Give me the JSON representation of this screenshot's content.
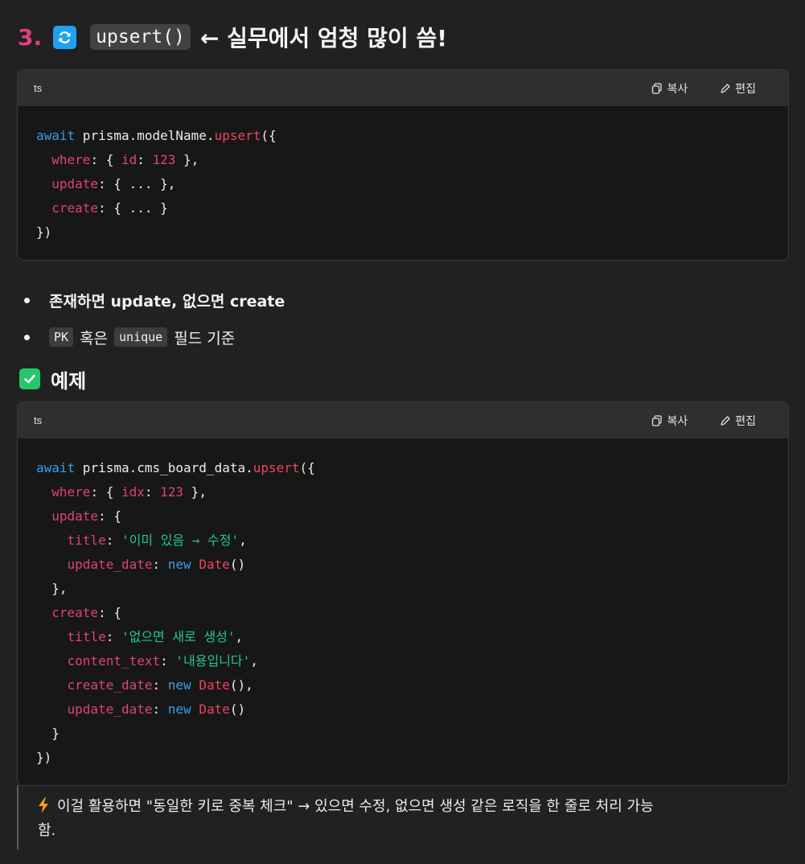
{
  "section": {
    "number": "3.",
    "code_title": "upsert()",
    "title_rest": "← 실무에서 엄청 많이 씀!"
  },
  "codeblock1": {
    "lang": "ts",
    "copy_label": "복사",
    "edit_label": "편집",
    "lines": [
      [
        {
          "t": "await",
          "c": "kw"
        },
        {
          "t": " prisma.modelName."
        },
        {
          "t": "upsert",
          "c": "fn"
        },
        {
          "t": "({"
        }
      ],
      [
        {
          "t": "  "
        },
        {
          "t": "where",
          "c": "prop"
        },
        {
          "t": ": { "
        },
        {
          "t": "id",
          "c": "prop"
        },
        {
          "t": ": "
        },
        {
          "t": "123",
          "c": "num"
        },
        {
          "t": " },"
        }
      ],
      [
        {
          "t": "  "
        },
        {
          "t": "update",
          "c": "prop"
        },
        {
          "t": ": { ... },"
        }
      ],
      [
        {
          "t": "  "
        },
        {
          "t": "create",
          "c": "prop"
        },
        {
          "t": ": { ... }"
        }
      ],
      [
        {
          "t": "})"
        }
      ]
    ]
  },
  "bullets": {
    "item1": "존재하면 update, 없으면 create",
    "item2_code1": "PK",
    "item2_mid": "혹은",
    "item2_code2": "unique",
    "item2_end": "필드 기준"
  },
  "example_heading": "예제",
  "codeblock2": {
    "lang": "ts",
    "copy_label": "복사",
    "edit_label": "편집",
    "lines": [
      [
        {
          "t": "await",
          "c": "kw"
        },
        {
          "t": " prisma.cms_board_data."
        },
        {
          "t": "upsert",
          "c": "fn"
        },
        {
          "t": "({"
        }
      ],
      [
        {
          "t": "  "
        },
        {
          "t": "where",
          "c": "prop"
        },
        {
          "t": ": { "
        },
        {
          "t": "idx",
          "c": "prop"
        },
        {
          "t": ": "
        },
        {
          "t": "123",
          "c": "num"
        },
        {
          "t": " },"
        }
      ],
      [
        {
          "t": "  "
        },
        {
          "t": "update",
          "c": "prop"
        },
        {
          "t": ": {"
        }
      ],
      [
        {
          "t": "    "
        },
        {
          "t": "title",
          "c": "prop"
        },
        {
          "t": ": "
        },
        {
          "t": "'이미 있음 → 수정'",
          "c": "str"
        },
        {
          "t": ","
        }
      ],
      [
        {
          "t": "    "
        },
        {
          "t": "update_date",
          "c": "prop"
        },
        {
          "t": ": "
        },
        {
          "t": "new",
          "c": "kw"
        },
        {
          "t": " "
        },
        {
          "t": "Date",
          "c": "fn"
        },
        {
          "t": "()"
        }
      ],
      [
        {
          "t": "  },"
        }
      ],
      [
        {
          "t": "  "
        },
        {
          "t": "create",
          "c": "prop"
        },
        {
          "t": ": {"
        }
      ],
      [
        {
          "t": "    "
        },
        {
          "t": "title",
          "c": "prop"
        },
        {
          "t": ": "
        },
        {
          "t": "'없으면 새로 생성'",
          "c": "str"
        },
        {
          "t": ","
        }
      ],
      [
        {
          "t": "    "
        },
        {
          "t": "content_text",
          "c": "prop"
        },
        {
          "t": ": "
        },
        {
          "t": "'내용입니다'",
          "c": "str"
        },
        {
          "t": ","
        }
      ],
      [
        {
          "t": "    "
        },
        {
          "t": "create_date",
          "c": "prop"
        },
        {
          "t": ": "
        },
        {
          "t": "new",
          "c": "kw"
        },
        {
          "t": " "
        },
        {
          "t": "Date",
          "c": "fn"
        },
        {
          "t": "(),"
        }
      ],
      [
        {
          "t": "    "
        },
        {
          "t": "update_date",
          "c": "prop"
        },
        {
          "t": ": "
        },
        {
          "t": "new",
          "c": "kw"
        },
        {
          "t": " "
        },
        {
          "t": "Date",
          "c": "fn"
        },
        {
          "t": "()"
        }
      ],
      [
        {
          "t": "  }"
        }
      ],
      [
        {
          "t": "})"
        }
      ]
    ]
  },
  "tip": {
    "text_line1": "이걸 활용하면 \"동일한 키로 중복 체크\" → 있으면 수정, 없으면 생성 같은 로직을 한 줄로 처리 가능",
    "text_line2": "함."
  },
  "colors": {
    "background": "#212121",
    "keyword": "#3b9de8",
    "function": "#f0445c",
    "property": "#e0407f",
    "string": "#22c88a",
    "check_emoji": "#26c76a",
    "refresh_emoji": "#1da1f2"
  }
}
